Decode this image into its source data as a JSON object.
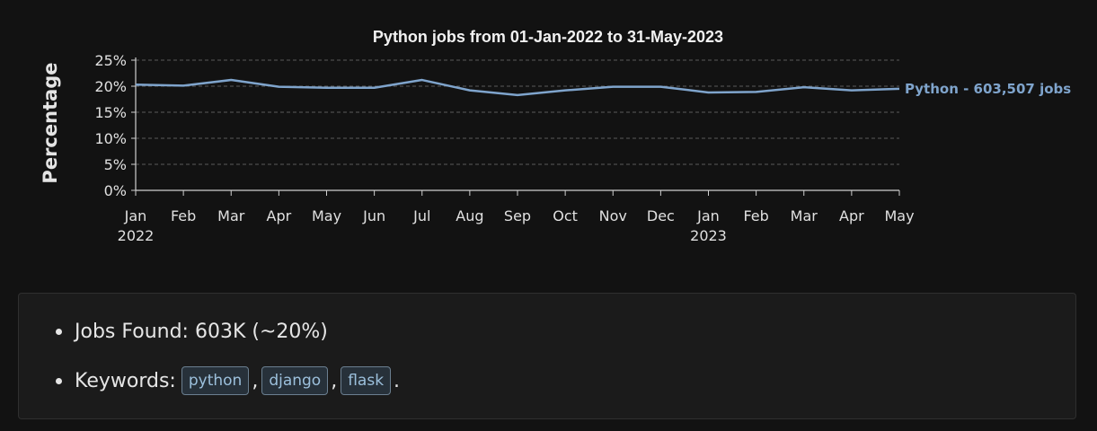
{
  "chart_data": {
    "type": "line",
    "title": "Python jobs from 01-Jan-2022 to 31-May-2023",
    "ylabel": "Percentage",
    "xlabel": "",
    "x": [
      "Jan",
      "Feb",
      "Mar",
      "Apr",
      "May",
      "Jun",
      "Jul",
      "Aug",
      "Sep",
      "Oct",
      "Nov",
      "Dec",
      "Jan",
      "Feb",
      "Mar",
      "Apr",
      "May"
    ],
    "x_sublabels": [
      "2022",
      "",
      "",
      "",
      "",
      "",
      "",
      "",
      "",
      "",
      "",
      "",
      "2023",
      "",
      "",
      "",
      ""
    ],
    "y_ticks": [
      "0%",
      "5%",
      "10%",
      "15%",
      "20%",
      "25%"
    ],
    "ylim": [
      0,
      25
    ],
    "grid": "horizontal dashed",
    "series": [
      {
        "name": "Python - 603,507 jobs",
        "color": "#7fa4cc",
        "values": [
          20.3,
          20.1,
          21.2,
          19.9,
          19.7,
          19.7,
          21.2,
          19.2,
          18.3,
          19.2,
          19.9,
          19.9,
          18.8,
          18.9,
          19.8,
          19.2,
          19.5
        ]
      }
    ]
  },
  "summary": {
    "jobs_found": "Jobs Found: 603K (~20%)",
    "keywords_label": "Keywords:",
    "keywords": [
      "python",
      "django",
      "flask"
    ],
    "keyword_separator": ",",
    "keyword_end": "."
  },
  "colors": {
    "background": "#121212",
    "axis": "#cfcfcf",
    "grid": "#5a5a5a",
    "tag_border": "#6b7f90",
    "tag_text": "#9cc0dc"
  }
}
